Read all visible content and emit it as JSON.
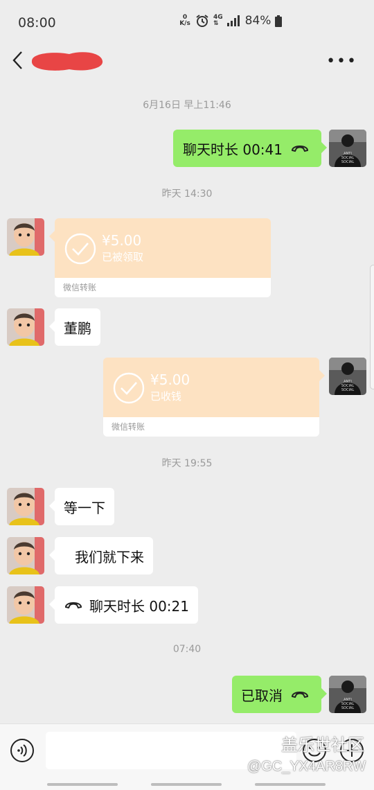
{
  "status_bar": {
    "time": "08:00",
    "speed_value": "0",
    "speed_unit": "K/s",
    "network": "4G",
    "battery": "84%"
  },
  "header": {
    "back_icon": "chevron-left",
    "contact_name": "",
    "more_icon": "more-dots"
  },
  "messages": [
    {
      "type": "timestamp",
      "text": "6月16日 早上11:46"
    },
    {
      "type": "call",
      "side": "right",
      "text": "聊天时长 00:41"
    },
    {
      "type": "timestamp",
      "text": "昨天 14:30"
    },
    {
      "type": "transfer",
      "side": "left",
      "amount": "¥5.00",
      "status": "已被领取",
      "footer": "微信转账"
    },
    {
      "type": "text",
      "side": "left",
      "text": "董鹏"
    },
    {
      "type": "transfer",
      "side": "right",
      "amount": "¥5.00",
      "status": "已收钱",
      "footer": "微信转账"
    },
    {
      "type": "timestamp",
      "text": "昨天 19:55"
    },
    {
      "type": "text",
      "side": "left",
      "text": "等一下"
    },
    {
      "type": "text",
      "side": "left",
      "text": "我们就下来"
    },
    {
      "type": "call",
      "side": "left",
      "text": "聊天时长 00:21"
    },
    {
      "type": "timestamp",
      "text": "07:40"
    },
    {
      "type": "call",
      "side": "right",
      "text": "已取消"
    }
  ],
  "my_avatar_text": "ANTI SOCIAL SOCIAL CLUB",
  "input_bar": {
    "voice_icon": "voice-icon",
    "emoji_icon": "emoji-icon",
    "plus_icon": "plus-icon"
  },
  "watermark": {
    "line1": "盖乐世社区",
    "line2": "@GC_YX4AR8RW"
  },
  "colors": {
    "background": "#ededed",
    "my_bubble": "#95ec69",
    "their_bubble": "#ffffff",
    "transfer": "#fde2c2",
    "timestamp_text": "#9a9a9a"
  }
}
